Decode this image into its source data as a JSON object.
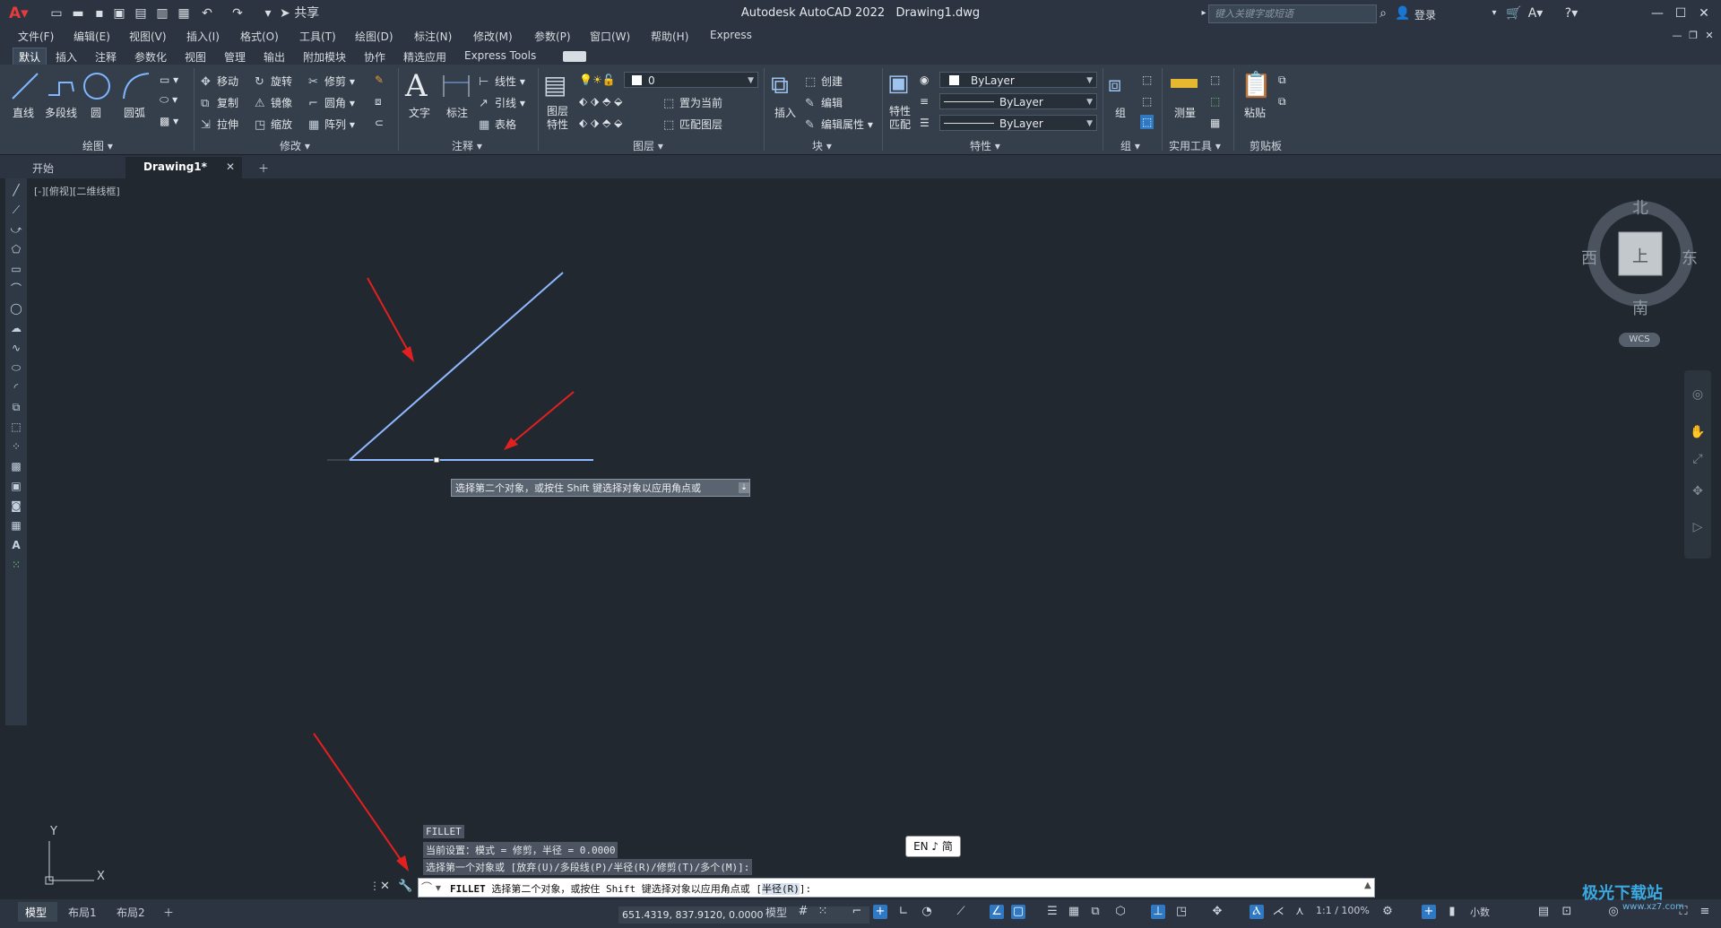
{
  "app": {
    "title": "Autodesk AutoCAD 2022",
    "document": "Drawing1.dwg",
    "share_label": "共享",
    "search_placeholder": "键入关键字或短语",
    "login_label": "登录"
  },
  "menu": [
    "文件(F)",
    "编辑(E)",
    "视图(V)",
    "插入(I)",
    "格式(O)",
    "工具(T)",
    "绘图(D)",
    "标注(N)",
    "修改(M)",
    "参数(P)",
    "窗口(W)",
    "帮助(H)",
    "Express"
  ],
  "ribbon_tabs": [
    "默认",
    "插入",
    "注释",
    "参数化",
    "视图",
    "管理",
    "输出",
    "附加模块",
    "协作",
    "精选应用",
    "Express Tools"
  ],
  "ribbon": {
    "draw": {
      "label": "绘图",
      "line": "直线",
      "pline": "多段线",
      "circle": "圆",
      "arc": "圆弧"
    },
    "modify": {
      "label": "修改",
      "move": "移动",
      "rotate": "旋转",
      "trim": "修剪",
      "copy": "复制",
      "mirror": "镜像",
      "fillet": "圆角",
      "stretch": "拉伸",
      "scale": "缩放",
      "array": "阵列"
    },
    "annotation": {
      "label": "注释",
      "text": "文字",
      "dim": "标注",
      "linear": "线性",
      "leader": "引线",
      "table": "表格"
    },
    "layers": {
      "label": "图层",
      "layer_props": "图层\n特性",
      "layer_name": "0",
      "set_current": "置为当前",
      "match_layer": "匹配图层"
    },
    "block": {
      "label": "块",
      "insert": "插入",
      "create": "创建",
      "edit": "编辑",
      "edit_attr": "编辑属性"
    },
    "properties": {
      "label": "特性",
      "match": "特性\n匹配",
      "color": "ByLayer",
      "linetype": "ByLayer",
      "lineweight": "ByLayer"
    },
    "groups": {
      "label": "组",
      "group": "组"
    },
    "utilities": {
      "label": "实用工具",
      "measure": "测量"
    },
    "clipboard": {
      "label": "剪贴板",
      "paste": "粘贴"
    }
  },
  "doc_tabs": {
    "start": "开始",
    "active": "Drawing1*"
  },
  "viewport_label": "[-][俯视][二维线框]",
  "tooltip": "选择第二个对象，或按住 Shift 键选择对象以应用角点或",
  "viewcube": {
    "north": "北",
    "south": "南",
    "east": "东",
    "west": "西",
    "face": "上",
    "wcs": "WCS"
  },
  "ucs": {
    "x": "X",
    "y": "Y"
  },
  "history": [
    "FILLET",
    "当前设置：模式 = 修剪，半径 = 0.0000",
    "选择第一个对象或 [放弃(U)/多段线(P)/半径(R)/修剪(T)/多个(M)]:"
  ],
  "command": {
    "name": "FILLET",
    "prompt": "选择第二个对象，或按住 Shift 键选择对象以应用角点或 [",
    "option": "半径(R)",
    "suffix": "]:"
  },
  "ime": "EN ♪ 简",
  "status": {
    "layouts": [
      "模型",
      "布局1",
      "布局2"
    ],
    "coords": "651.4319, 837.9120, 0.0000",
    "model": "模型",
    "scale": "1:1 / 100%",
    "units": "小数"
  },
  "watermark": "极光下载站",
  "watermark_url": "www.xz7.com"
}
